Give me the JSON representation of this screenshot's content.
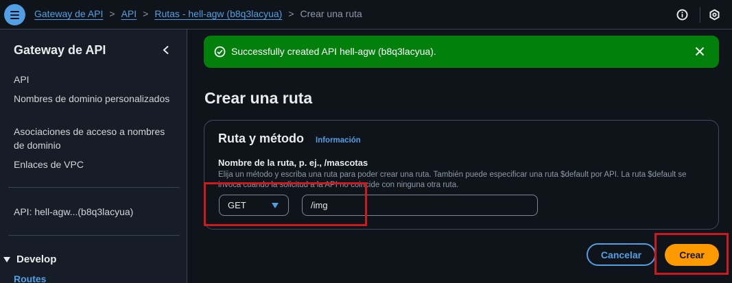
{
  "topbar": {
    "breadcrumbs": [
      {
        "label": "Gateway de API",
        "link": true
      },
      {
        "label": "API",
        "link": true
      },
      {
        "label": "Rutas - hell-agw (b8q3lacyua)",
        "link": true
      },
      {
        "label": "Crear una ruta",
        "link": false
      }
    ],
    "separator": ">",
    "menu_icon": "hamburger-menu-icon",
    "info_icon": "info-icon",
    "settings_icon": "hexagon-settings-icon"
  },
  "sidebar": {
    "title": "Gateway de API",
    "items": [
      {
        "label": "API"
      },
      {
        "label": "Nombres de dominio personalizados"
      },
      {
        "label": "Asociaciones de acceso a nombres de dominio"
      },
      {
        "label": "Enlaces de VPC"
      }
    ],
    "api_label": "API: hell-agw...(b8q3lacyua)",
    "section_label": "Develop",
    "section_item": "Routes"
  },
  "flash": {
    "message": "Successfully created API hell-agw (b8q3lacyua).",
    "type": "success"
  },
  "page": {
    "title": "Crear una ruta"
  },
  "form": {
    "container_title": "Ruta y método",
    "info_link": "Información",
    "field_label": "Nombre de la ruta, p. ej., /mascotas",
    "field_description": "Elija un método y escriba una ruta para poder crear una ruta. También puede especificar una ruta $default por API. La ruta $default se invoca cuando la solicitud a la API no coincide con ninguna otra ruta.",
    "method_value": "GET",
    "path_value": "/img"
  },
  "actions": {
    "cancel_label": "Cancelar",
    "create_label": "Crear"
  },
  "colors": {
    "accent": "#539fe5",
    "success": "#037f0c",
    "primary_button": "#ff9900",
    "highlight": "#d0191f"
  }
}
